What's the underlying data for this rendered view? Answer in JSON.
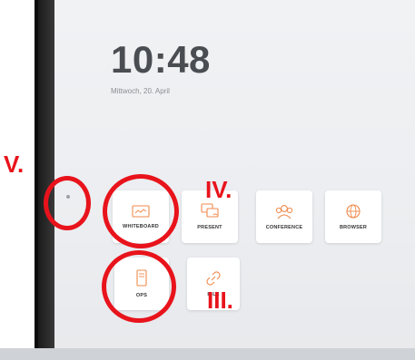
{
  "clock": {
    "time": "10:48",
    "date": "Mittwoch, 20. April"
  },
  "apps": [
    {
      "label": "WHITEBOARD",
      "icon": "whiteboard-icon"
    },
    {
      "label": "PRESENT",
      "icon": "present-icon"
    },
    {
      "label": "CONFERENCE",
      "icon": "conference-icon"
    },
    {
      "label": "BROWSER",
      "icon": "browser-icon"
    },
    {
      "label": "OPS",
      "icon": "ops-icon"
    },
    {
      "label": "IBLE",
      "icon": "link-icon"
    }
  ],
  "annotations": {
    "v": "V.",
    "iv": "IV.",
    "iii": "III."
  },
  "colors": {
    "accent": "#f08a4b",
    "annotation": "#e8131b",
    "text": "#4a4d52"
  }
}
